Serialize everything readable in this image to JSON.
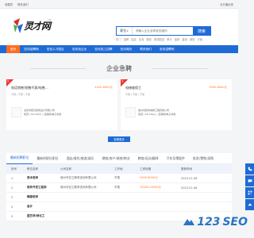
{
  "topbar": {
    "left": [
      "收藏夹",
      "联系我们"
    ],
    "right": [
      "天天播出来"
    ]
  },
  "logo": {
    "text": "灵才网",
    "tm": "TM"
  },
  "search": {
    "select_label": "职位",
    "placeholder": "请输入企业名称或关键词",
    "button": "搜索",
    "hot_label": "热门",
    "hot": [
      "招聘",
      "招店",
      "业务",
      "服务",
      "物流配送",
      "审计",
      "装修",
      "建设",
      "销售",
      "行政"
    ]
  },
  "nav": [
    "首页",
    "宏伟招聘网",
    "宏伟人才园区",
    "宏伟找企业",
    "宏伟找工招聘",
    "宏伟简历",
    "联系我们",
    "宏伟招聘网"
  ],
  "section_title": "企业急聘",
  "cards": [
    {
      "tag": "急",
      "title": "电话销售(销售代表/电售...",
      "salary": "4000-6000元",
      "meta": "不限 | 不限 | 不限",
      "company": "太原市阳光建筑设计有限公司",
      "company_meta": "民营 | 50-150人 | 互联网/电子商务"
    },
    {
      "tag": "急",
      "title": "电梯维保工",
      "salary": "5000-8000元",
      "meta": "不限 | 不限 | 不限",
      "company": "宿州市建筑电梯工程有限公司",
      "company_meta": "民营 | 50-150人 | 互联网/电子商务"
    }
  ],
  "more_button": "查看更多",
  "tabs": [
    "最新招聘职位",
    "最新的职位职位",
    "酒店/餐饮/旅游/娱乐",
    "建筑/房产/装修/物业",
    "教育/培训/翻译",
    "汽车及零配件",
    "批发/零售/采购"
  ],
  "table": {
    "headers": [
      "序号",
      "职位名称",
      "公司名称",
      "工作地",
      "工资待遇",
      "更新时间"
    ],
    "rows": [
      [
        "1",
        "美术老师",
        "宿州市宏立教育咨询有限公司",
        "不限",
        "5000-8000元",
        "2023-01-06"
      ],
      [
        "2",
        "软件开发工程师",
        "宿州市宏立教育咨询有限公司",
        "不限",
        "10000-20000元",
        "2023-01-06"
      ],
      [
        "3",
        "舞蹈老师",
        "",
        "",
        "",
        ""
      ],
      [
        "4",
        "会计",
        "",
        "",
        "",
        ""
      ],
      [
        "5",
        "园艺师/绿化工",
        "",
        "",
        "",
        ""
      ]
    ]
  },
  "side_buttons": [
    "phone-icon",
    "chat-icon",
    "qr-icon",
    "top-icon"
  ],
  "watermark": {
    "text": "SEO",
    "prefix": "123"
  },
  "colors": {
    "primary": "#1e6bd6",
    "accent": "#fe6c22",
    "salary": "#ff7a1f"
  }
}
